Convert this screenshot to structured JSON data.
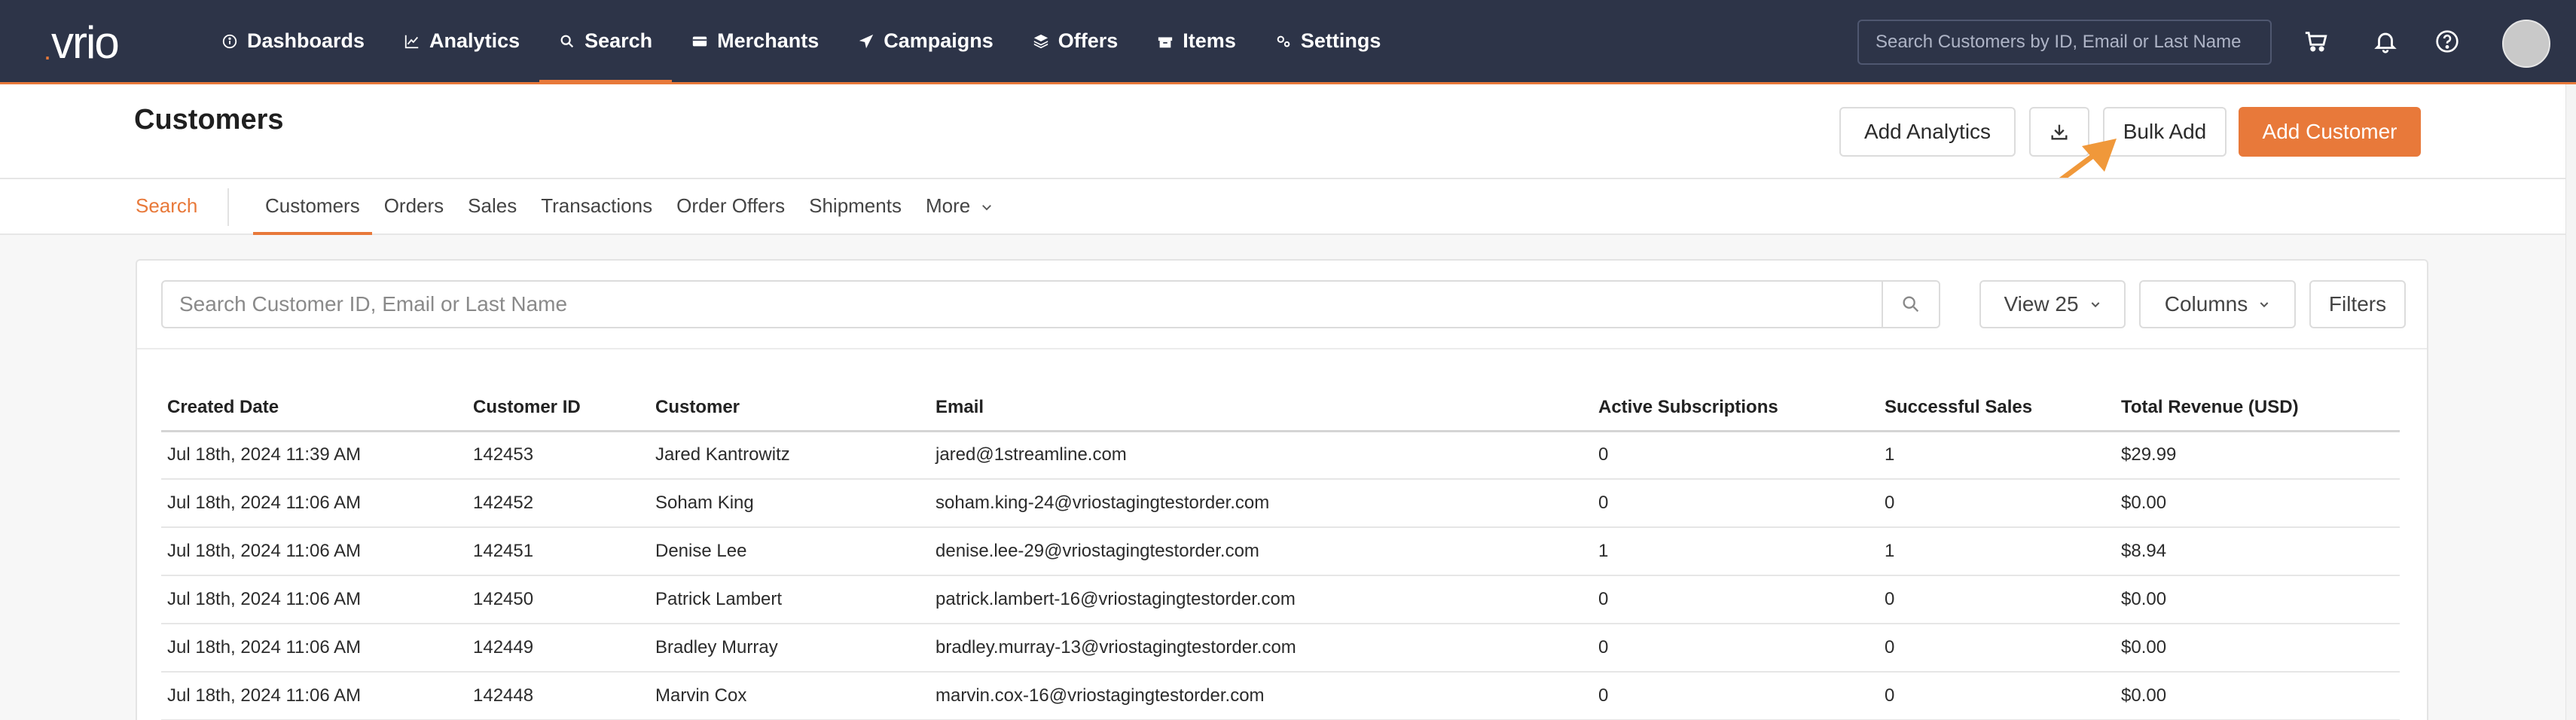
{
  "app": {
    "logo": "vrio",
    "nav": [
      {
        "label": "Dashboards",
        "icon": "info-circle-icon"
      },
      {
        "label": "Analytics",
        "icon": "line-chart-icon"
      },
      {
        "label": "Search",
        "icon": "search-icon"
      },
      {
        "label": "Merchants",
        "icon": "credit-card-icon"
      },
      {
        "label": "Campaigns",
        "icon": "paper-plane-icon"
      },
      {
        "label": "Offers",
        "icon": "layers-icon"
      },
      {
        "label": "Items",
        "icon": "box-icon"
      },
      {
        "label": "Settings",
        "icon": "gears-icon"
      }
    ],
    "active_nav": "Search",
    "global_search_placeholder": "Search Customers by ID, Email or Last Name"
  },
  "page": {
    "title": "Customers",
    "buttons": {
      "add_analytics": "Add Analytics",
      "bulk_add": "Bulk Add",
      "add_customer": "Add Customer"
    }
  },
  "subnav": {
    "label": "Search",
    "tabs": [
      "Customers",
      "Orders",
      "Sales",
      "Transactions",
      "Order Offers",
      "Shipments",
      "More"
    ],
    "active": "Customers"
  },
  "table_toolbar": {
    "search_placeholder": "Search Customer ID, Email or Last Name",
    "view": "View 25",
    "columns": "Columns",
    "filters": "Filters"
  },
  "table": {
    "columns": [
      "Created Date",
      "Customer ID",
      "Customer",
      "Email",
      "Active Subscriptions",
      "Successful Sales",
      "Total Revenue (USD)"
    ],
    "rows": [
      [
        "Jul 18th, 2024 11:39 AM",
        "142453",
        "Jared Kantrowitz",
        "jared@1streamline.com",
        "0",
        "1",
        "$29.99"
      ],
      [
        "Jul 18th, 2024 11:06 AM",
        "142452",
        "Soham King",
        "soham.king-24@vriostagingtestorder.com",
        "0",
        "0",
        "$0.00"
      ],
      [
        "Jul 18th, 2024 11:06 AM",
        "142451",
        "Denise Lee",
        "denise.lee-29@vriostagingtestorder.com",
        "1",
        "1",
        "$8.94"
      ],
      [
        "Jul 18th, 2024 11:06 AM",
        "142450",
        "Patrick Lambert",
        "patrick.lambert-16@vriostagingtestorder.com",
        "0",
        "0",
        "$0.00"
      ],
      [
        "Jul 18th, 2024 11:06 AM",
        "142449",
        "Bradley Murray",
        "bradley.murray-13@vriostagingtestorder.com",
        "0",
        "0",
        "$0.00"
      ],
      [
        "Jul 18th, 2024 11:06 AM",
        "142448",
        "Marvin Cox",
        "marvin.cox-16@vriostagingtestorder.com",
        "0",
        "0",
        "$0.00"
      ]
    ]
  },
  "colors": {
    "nav_bg": "#2d3448",
    "accent": "#e8793a",
    "annotation_arrow": "#f0983a"
  }
}
